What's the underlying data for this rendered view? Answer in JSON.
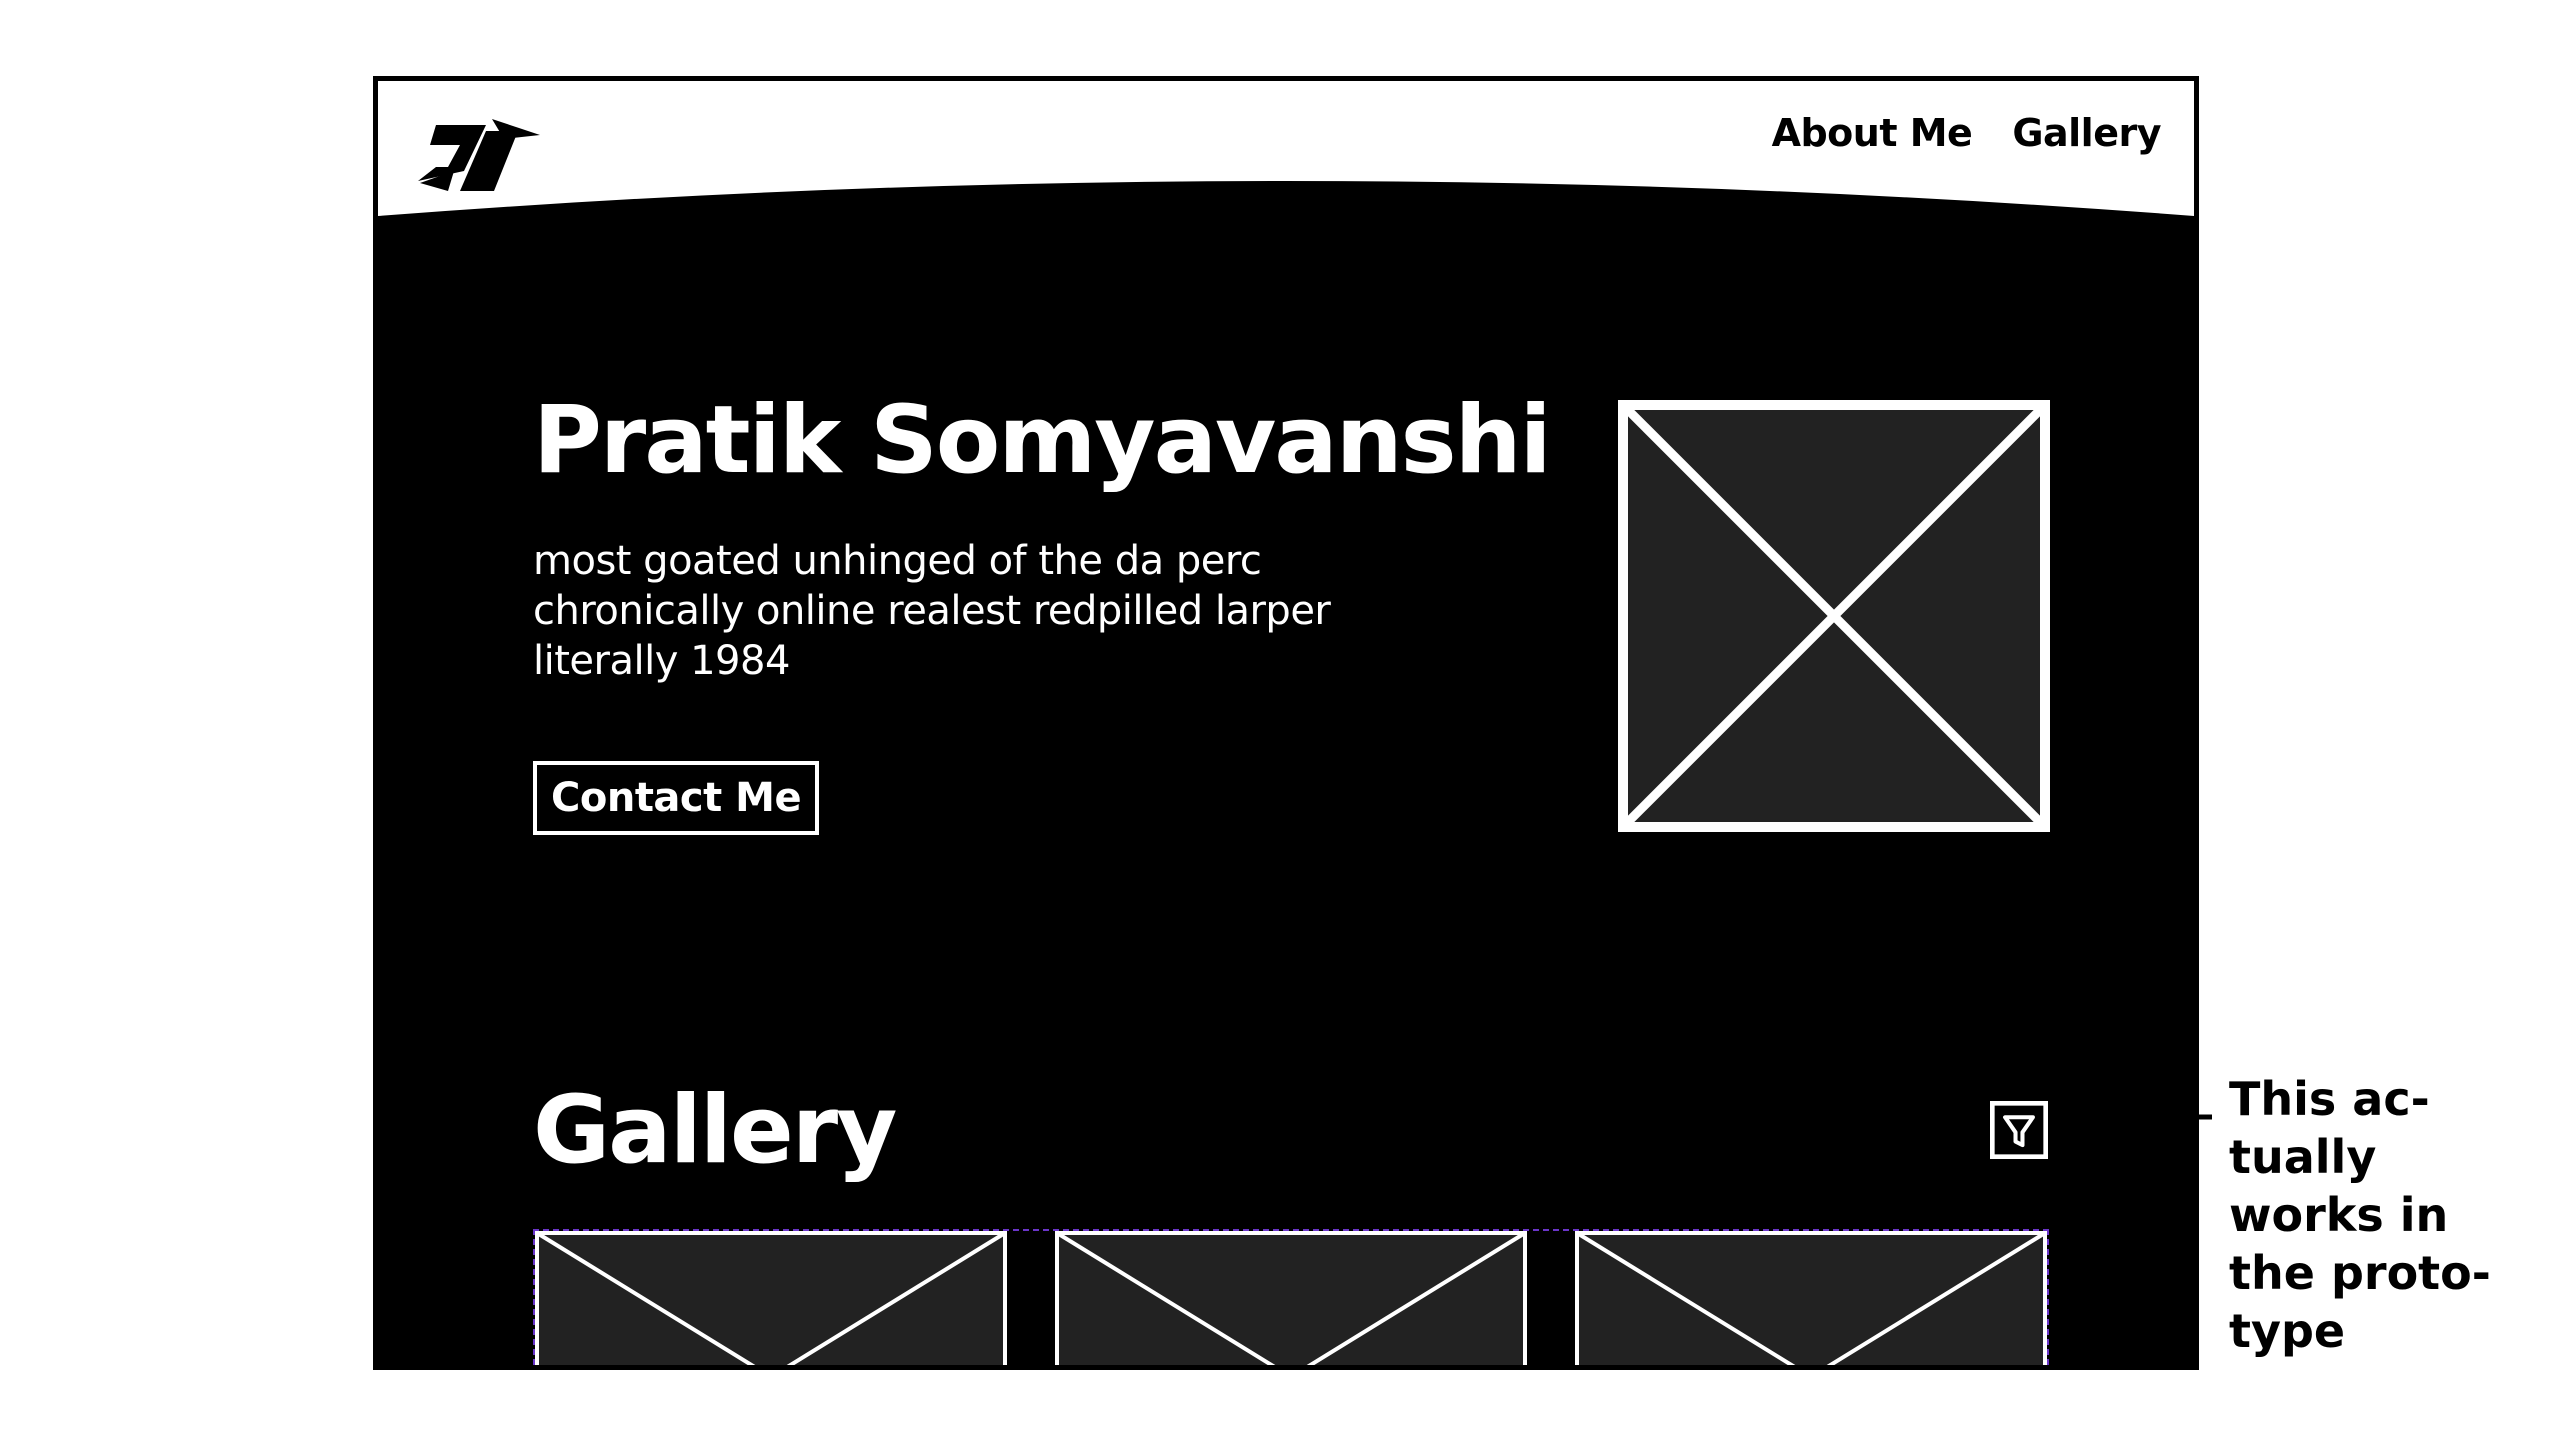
{
  "header": {
    "logo_icon": "angular-brand-logo-icon",
    "nav": [
      {
        "label": "About Me"
      },
      {
        "label": "Gallery"
      }
    ]
  },
  "hero": {
    "title": "Pratik Somyavanshi",
    "subtitle_lines": [
      "most goated unhinged of the da perc",
      "chronically online realest redpilled larper",
      "literally 1984"
    ],
    "contact_label": "Contact Me",
    "image_icon": "image-placeholder-icon"
  },
  "gallery": {
    "title": "Gallery",
    "filter_icon": "filter-icon",
    "thumbnail_count_visible": 3
  },
  "annotation": {
    "lines": [
      "This ac-",
      "tually",
      "works in",
      "the proto-",
      "type"
    ]
  },
  "colors": {
    "page_background": "#000000",
    "header_background": "#ffffff",
    "placeholder_fill": "#222222",
    "text": "#ffffff",
    "selection_outline": "#6a35c9"
  }
}
